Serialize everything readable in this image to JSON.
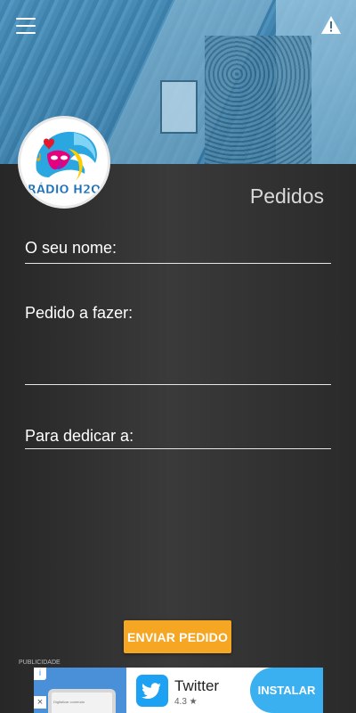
{
  "app": {
    "logo_text": "RÁDIO H2O",
    "page_title": "Pedidos"
  },
  "header": {
    "menu_icon": "hamburger-menu-icon",
    "alert_icon": "warning-triangle-icon"
  },
  "form": {
    "name_label": "O seu nome:",
    "request_label": "Pedido a fazer:",
    "dedicate_label": "Para dedicar a:",
    "submit_label": "ENVIAR PEDIDO"
  },
  "ad": {
    "tag": "PUBLICIDADE",
    "app_name": "Twitter",
    "rating": "4.3 ★",
    "install_label": "INSTALAR",
    "info_icon": "i",
    "close_icon": "×",
    "screenshot_text": "Digitalizar conteúdo"
  },
  "colors": {
    "accent": "#f5a623",
    "install": "#3ab0f0",
    "twitter": "#1da1f2"
  }
}
